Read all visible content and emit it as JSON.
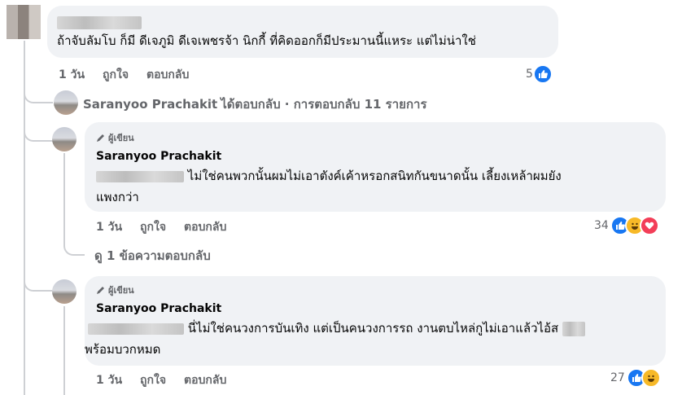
{
  "top_comment": {
    "text": "ถ้าจับลัมโบ ก็มี ดีเจภูมิ ดีเจเพชรจ้า นิกกี้ ที่คิดออกก็มีประมานนี้แหระ แต่ไม่น่าใช่",
    "time": "1 วัน",
    "like_label": "ถูกใจ",
    "reply_label": "ตอบกลับ",
    "reaction_count": "5"
  },
  "replied_summary": {
    "name": "Saranyoo Prachakit",
    "text": "ได้ตอบกลับ · การตอบกลับ 11 รายการ"
  },
  "reply1": {
    "author_tag": "ผู้เขียน",
    "name": "Saranyoo Prachakit",
    "line1": "ไม่ใช่คนพวกนั้นผมไม่เอาตังค์เค้าหรอกสนิทกันขนาดนั้น เลี้ยงเหล้าผมยัง",
    "line2": "แพงกว่า",
    "time": "1 วัน",
    "like_label": "ถูกใจ",
    "reply_label": "ตอบกลับ",
    "reaction_count": "34",
    "view_replies": "ดู 1 ข้อความตอบกลับ"
  },
  "reply2": {
    "author_tag": "ผู้เขียน",
    "name": "Saranyoo Prachakit",
    "line1": "นี่ไม่ใช่คนวงการบันเทิง แต่เป็นคนวงการรถ งานตบไหล่กูไม่เอาแล้วไอ้ส",
    "line2": "พร้อมบวกหมด",
    "time": "1 วัน",
    "like_label": "ถูกใจ",
    "reply_label": "ตอบกลับ",
    "reaction_count": "27"
  },
  "colors": {
    "bubble": "#f0f2f5",
    "secondary_text": "#65676b",
    "like_blue": "#1877f2",
    "haha_yellow": "#f7b928",
    "love_red": "#f33e58"
  }
}
